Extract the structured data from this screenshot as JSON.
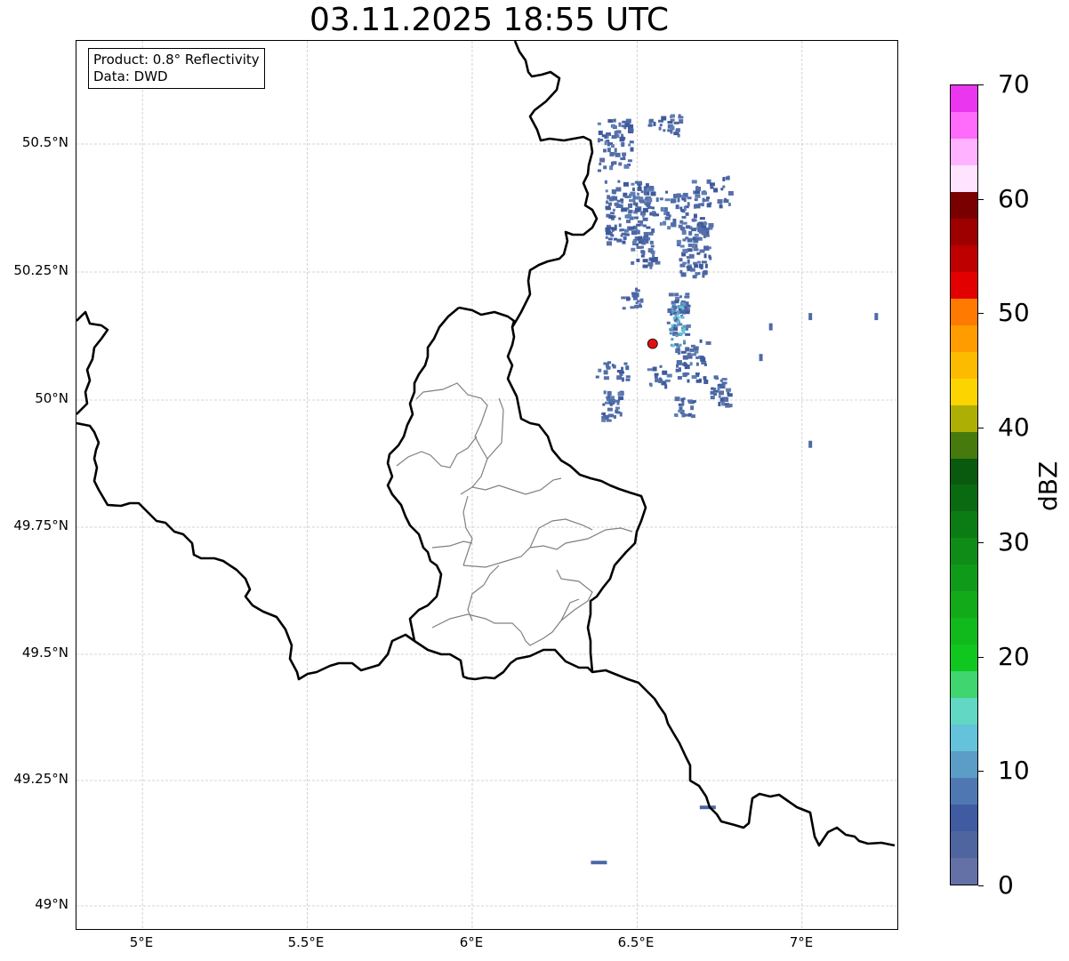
{
  "title": "03.11.2025 18:55 UTC",
  "infobox": {
    "product": "Product: 0.8° Reflectivity",
    "data": "Data: DWD"
  },
  "axes": {
    "lon_ticks": [
      "5°E",
      "5.5°E",
      "6°E",
      "6.5°E",
      "7°E"
    ],
    "lat_ticks": [
      "50.5°N",
      "50.25°N",
      "50°N",
      "49.75°N",
      "49.5°N",
      "49.25°N",
      "49°N"
    ],
    "grid": "dashed light gray",
    "extent_lon": [
      4.8,
      7.3
    ],
    "extent_lat": [
      48.95,
      50.7
    ]
  },
  "colorbar": {
    "label": "dBZ",
    "ticks": [
      "0",
      "10",
      "20",
      "30",
      "40",
      "50",
      "60",
      "70"
    ],
    "range": [
      0,
      70
    ],
    "step": 2.5,
    "colors": [
      "#6371a6",
      "#4f65a0",
      "#415ba2",
      "#4f78b2",
      "#5c9dc7",
      "#64c2da",
      "#62d7c3",
      "#3fd56f",
      "#0fc71f",
      "#10b91c",
      "#12aa19",
      "#0f9b19",
      "#0e8c17",
      "#0b7b14",
      "#0a6a12",
      "#09590e",
      "#467a0c",
      "#aeaf05",
      "#fcd400",
      "#fdbb00",
      "#fe9c00",
      "#fe7a00",
      "#e20000",
      "#bf0000",
      "#9e0000",
      "#7a0000",
      "#ffe3ff",
      "#ffb2ff",
      "#ff6bfa",
      "#ea36ee"
    ]
  },
  "radar_site": {
    "lon": 6.547,
    "lat": 50.11,
    "color": "#e01010"
  },
  "map_layers": [
    "country borders",
    "Luxembourg canton borders",
    "radar reflectivity echoes"
  ]
}
